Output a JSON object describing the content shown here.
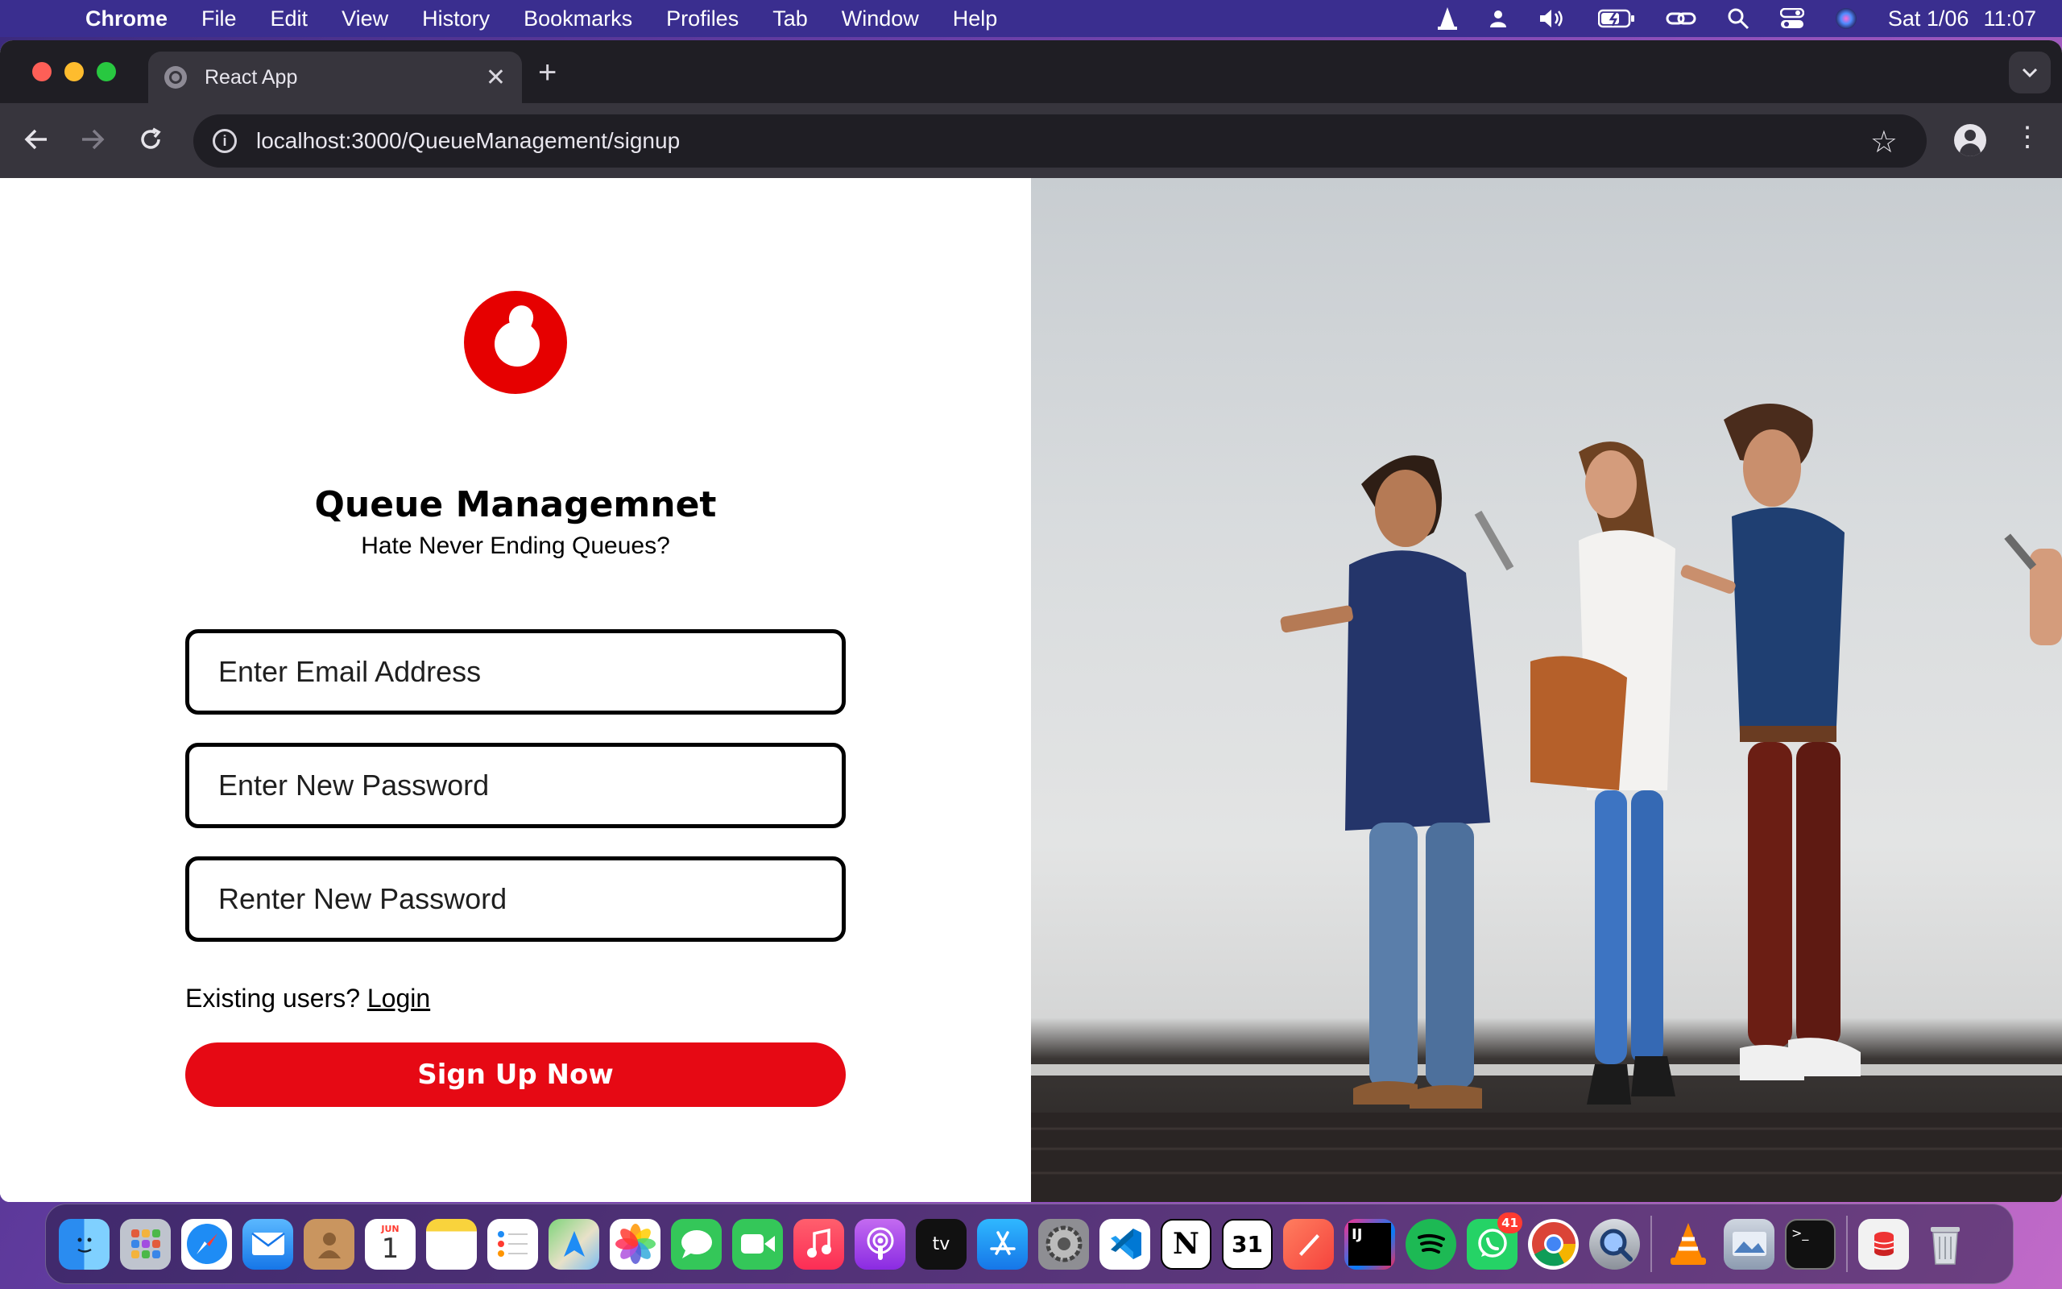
{
  "menubar": {
    "app_name": "Chrome",
    "items": [
      "File",
      "Edit",
      "View",
      "History",
      "Bookmarks",
      "Profiles",
      "Tab",
      "Window",
      "Help"
    ],
    "date": "Sat 1/06",
    "time": "11:07"
  },
  "browser": {
    "tab_title": "React App",
    "tab_close": "✕",
    "new_tab": "+",
    "url": "localhost:3000/QueueManagement/signup"
  },
  "page": {
    "title": "Queue Managemnet",
    "subtitle": "Hate Never Ending Queues?",
    "email_placeholder": "Enter Email Address",
    "password_placeholder": "Enter New Password",
    "repassword_placeholder": "Renter New Password",
    "existing_text": "Existing users? ",
    "login_link": "Login",
    "signup_button": "Sign Up Now"
  },
  "colors": {
    "brand_red": "#e60000",
    "button_red": "#e60914"
  },
  "dock": {
    "calendar_month": "JUN",
    "calendar_day": "1",
    "whatsapp_badge": "41",
    "items": [
      "finder-icon",
      "launchpad-icon",
      "safari-icon",
      "mail-icon",
      "contacts-icon",
      "calendar-icon",
      "notes-icon",
      "reminders-icon",
      "maps-icon",
      "photos-icon",
      "messages-icon",
      "facetime-icon",
      "music-icon",
      "podcasts-icon",
      "tv-icon",
      "app-store-icon",
      "system-settings-icon",
      "vscode-icon",
      "notion-icon",
      "notion-calendar-icon",
      "xcode-paintbrush-icon",
      "intellij-icon",
      "spotify-icon",
      "whatsapp-icon",
      "chrome-icon",
      "quicktime-icon",
      "vlc-icon",
      "preview-icon",
      "terminal-icon",
      "document-icon",
      "trash-icon"
    ]
  }
}
